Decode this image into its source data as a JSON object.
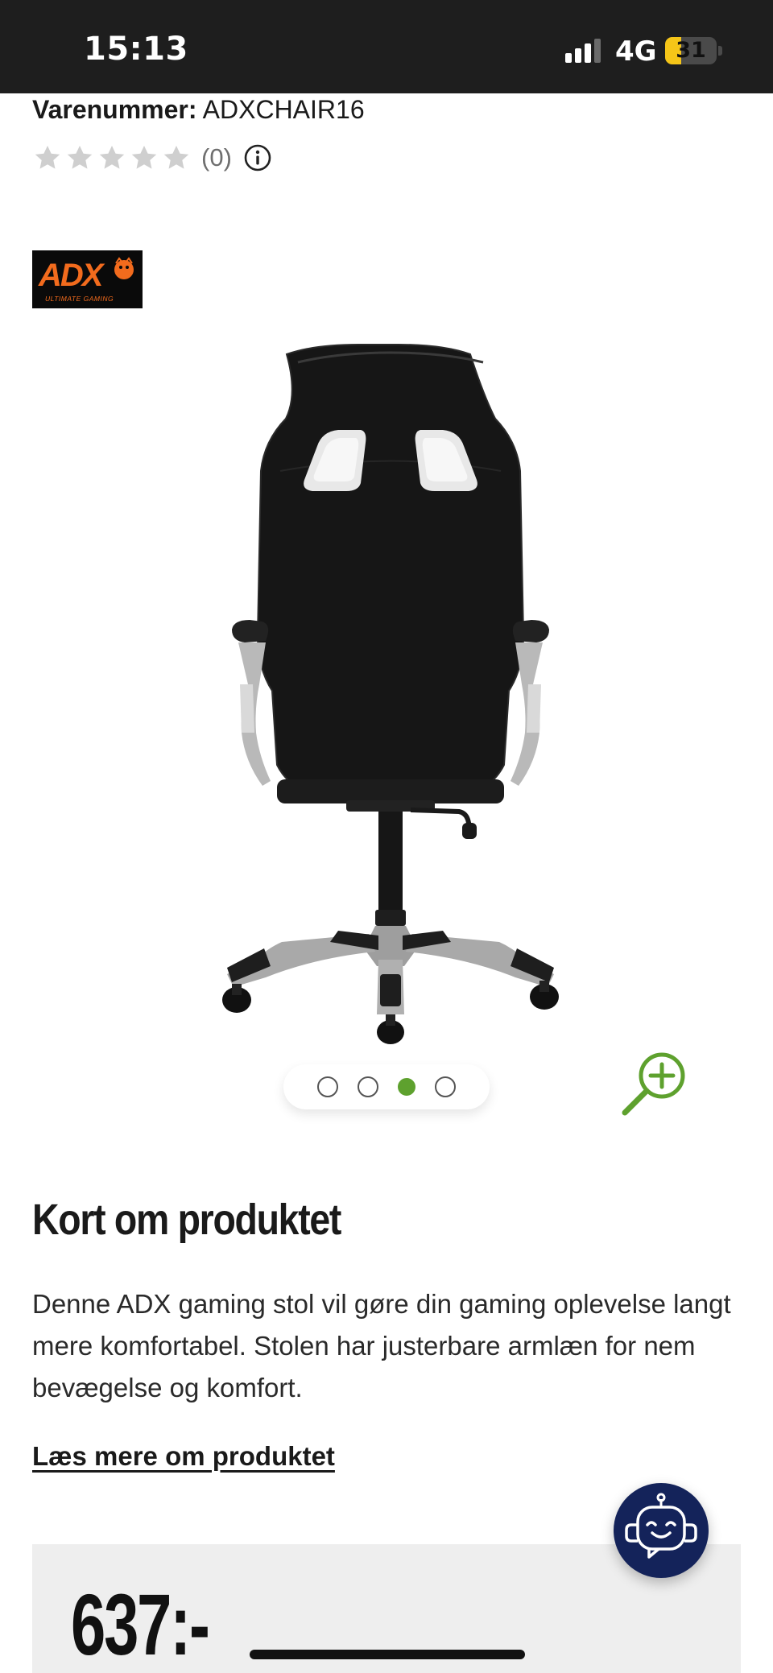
{
  "status_bar": {
    "time": "15:13",
    "network": "4G",
    "battery_level": "31",
    "battery_fraction": 0.31
  },
  "product": {
    "sku_label": "Varenummer:",
    "sku_value": "ADXCHAIR16",
    "rating_stars": 0,
    "rating_count": "(0)",
    "brand_logo_text": "ADX",
    "brand_logo_subtext": "ULTIMATE GAMING"
  },
  "gallery": {
    "image_count": 4,
    "active_index": 2
  },
  "about": {
    "title": "Kort om produktet",
    "description": "Denne ADX gaming stol vil gøre din gaming oplevelse langt mere komfortabel. Stolen har justerbare armlæn for nem bevægelse og komfort.",
    "read_more": "Læs mere om produktet"
  },
  "price": {
    "value": "637:-"
  },
  "colors": {
    "accent_green": "#5ea12e",
    "chat_navy": "#14235a",
    "brand_orange": "#f26b1d"
  },
  "icons": {
    "info": "info-icon",
    "zoom": "zoom-in-icon",
    "chat": "robot-icon",
    "star": "star-icon"
  }
}
